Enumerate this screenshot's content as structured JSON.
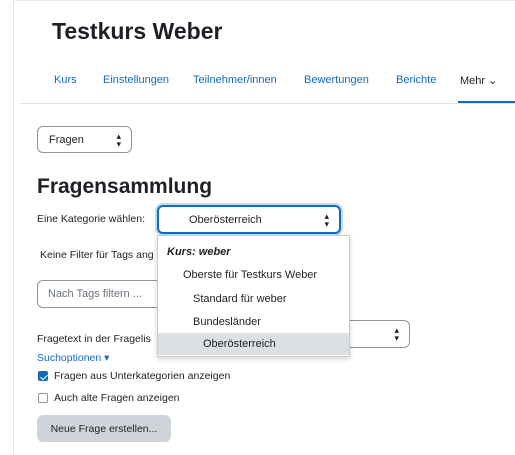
{
  "course": {
    "title": "Testkurs Weber"
  },
  "nav": {
    "items": [
      {
        "label": "Kurs"
      },
      {
        "label": "Einstellungen"
      },
      {
        "label": "Teilnehmer/innen"
      },
      {
        "label": "Bewertungen"
      },
      {
        "label": "Berichte"
      },
      {
        "label": "Mehr ⌄"
      }
    ]
  },
  "page_select": {
    "value": "Fragen",
    "arrows": "▴\n▾"
  },
  "heading": "Fragensammlung",
  "category": {
    "label": "Eine Kategorie wählen:",
    "value": "Oberösterreich",
    "dropdown": [
      {
        "label": "Kurs: weber",
        "type": "group"
      },
      {
        "label": "Oberste für Testkurs Weber",
        "type": "option"
      },
      {
        "label": "Standard für weber",
        "type": "option"
      },
      {
        "label": "Bundesländer",
        "type": "option"
      },
      {
        "label": "Oberösterreich",
        "type": "option",
        "selected": true
      }
    ]
  },
  "tags": {
    "no_filter_text": "Keine Filter für Tags ang",
    "placeholder": "Nach Tags filtern ..."
  },
  "fragetext_label": "Fragetext in der Fragelis",
  "search_options_label": "Suchoptionen ▾",
  "checkboxes": [
    {
      "label": "Fragen aus Unterkategorien anzeigen",
      "checked": true
    },
    {
      "label": "Auch alte Fragen anzeigen",
      "checked": false
    }
  ],
  "new_question_button": "Neue Frage erstellen...",
  "colors": {
    "accent": "#0f6cbf",
    "button_bg": "#ced4da",
    "border": "#8f959e",
    "selected_bg": "#dde0e3"
  }
}
